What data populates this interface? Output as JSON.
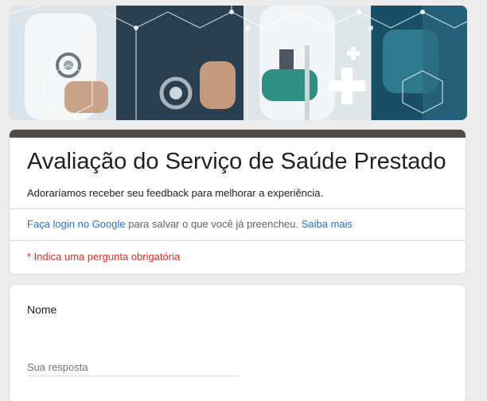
{
  "banner": {
    "image_name": "medical-team-banner-image"
  },
  "form": {
    "title": "Avaliação do Serviço de Saúde Prestado",
    "description": "Adoraríamos receber seu feedback para melhorar a experiência.",
    "login_link": "Faça login no Google",
    "login_text": " para salvar o que você já preencheu. ",
    "learn_more_link": "Saiba mais",
    "required_note": "* Indica uma pergunta obrigatória"
  },
  "question": {
    "label": "Nome",
    "placeholder": "Sua resposta",
    "value": ""
  },
  "colors": {
    "header_strip": "#4f4b48",
    "link": "#1a73e8",
    "required": "#d93025",
    "background": "#ececec"
  }
}
